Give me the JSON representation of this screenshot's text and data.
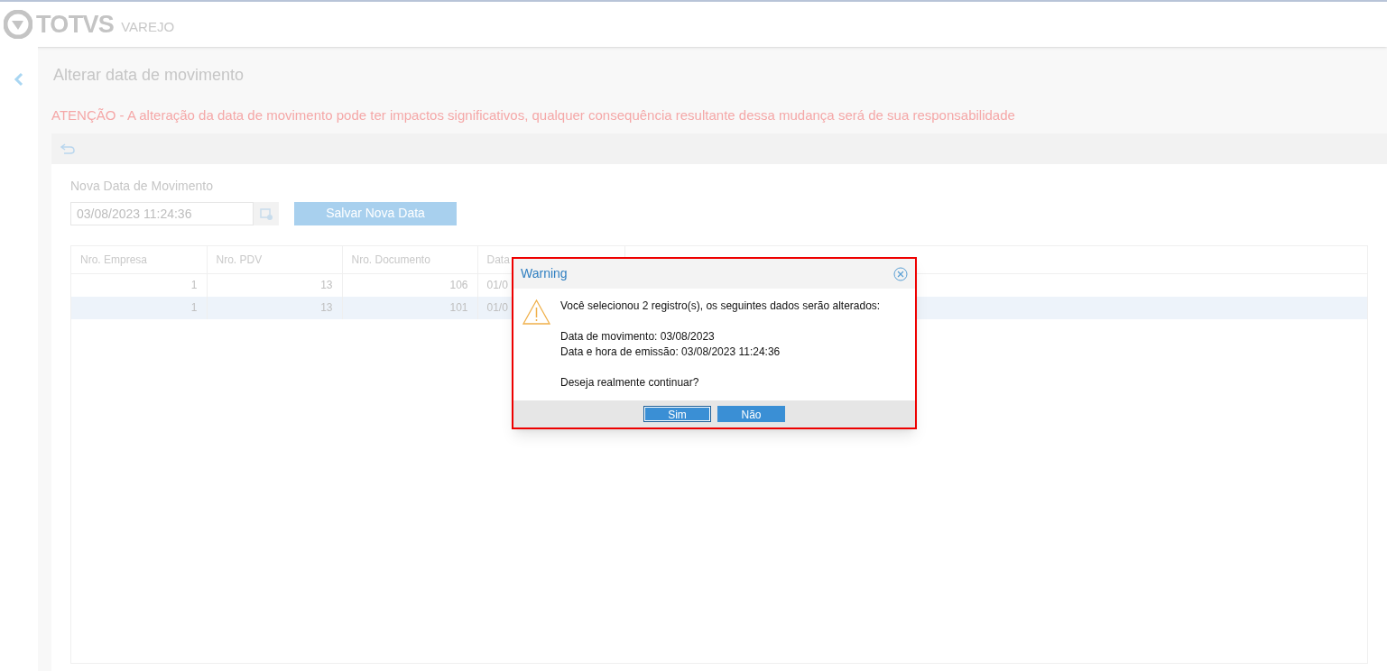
{
  "header": {
    "logo": "TOTVS",
    "product": "VAREJO"
  },
  "page": {
    "title": "Alterar data de movimento",
    "warning": "ATENÇÃO - A alteração da data de movimento pode ter impactos significativos, qualquer consequência resultante dessa mudança será de sua responsabilidade"
  },
  "form": {
    "label": "Nova Data de Movimento",
    "value": "03/08/2023 11:24:36",
    "save_button": "Salvar Nova Data"
  },
  "table": {
    "columns": [
      "Nro. Empresa",
      "Nro. PDV",
      "Nro. Documento",
      "Data"
    ],
    "rows": [
      {
        "cells": [
          "1",
          "13",
          "106",
          "01/0"
        ],
        "selected": false
      },
      {
        "cells": [
          "1",
          "13",
          "101",
          "01/0"
        ],
        "selected": true
      }
    ]
  },
  "dialog": {
    "title": "Warning",
    "paragraphs": [
      [
        "Você selecionou 2 registro(s), os seguintes dados serão alterados:"
      ],
      [
        "Data de movimento: 03/08/2023",
        "Data e hora de emissão: 03/08/2023 11:24:36"
      ],
      [
        "Deseja realmente continuar?"
      ]
    ],
    "buttons": [
      {
        "label": "Sim",
        "focused": true
      },
      {
        "label": "Não",
        "focused": false
      }
    ]
  }
}
